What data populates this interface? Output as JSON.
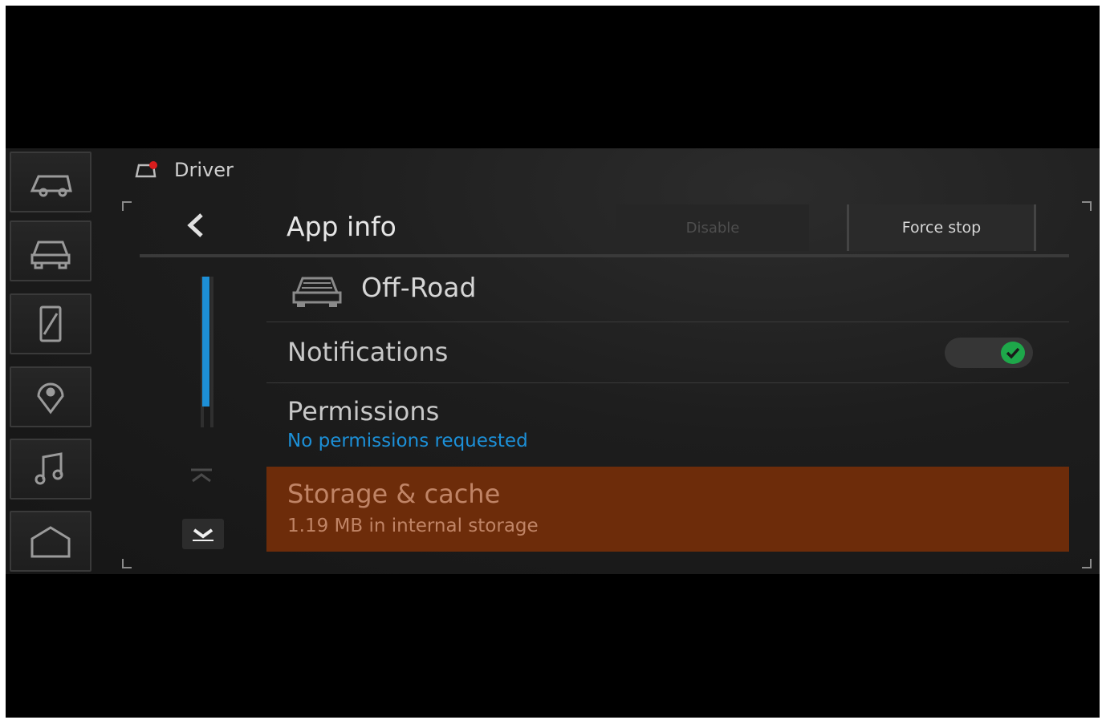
{
  "status": {
    "profile_label": "Driver"
  },
  "appbar": {
    "title": "App info",
    "disable_label": "Disable",
    "force_stop_label": "Force stop"
  },
  "app": {
    "name": "Off-Road",
    "icon": "offroad-car-icon"
  },
  "settings": {
    "notifications": {
      "label": "Notifications",
      "enabled": true
    },
    "permissions": {
      "label": "Permissions",
      "subtitle": "No permissions requested"
    },
    "storage": {
      "label": "Storage & cache",
      "subtitle": "1.19 MB in internal storage"
    }
  },
  "rail": [
    {
      "name": "vehicle-icon"
    },
    {
      "name": "offroad-icon"
    },
    {
      "name": "phone-icon"
    },
    {
      "name": "navigation-icon"
    },
    {
      "name": "music-icon"
    },
    {
      "name": "home-icon"
    }
  ],
  "colors": {
    "accent_blue": "#1d8fd6",
    "selected_row": "#6d2c0a",
    "toggle_on": "#1ea84a"
  }
}
